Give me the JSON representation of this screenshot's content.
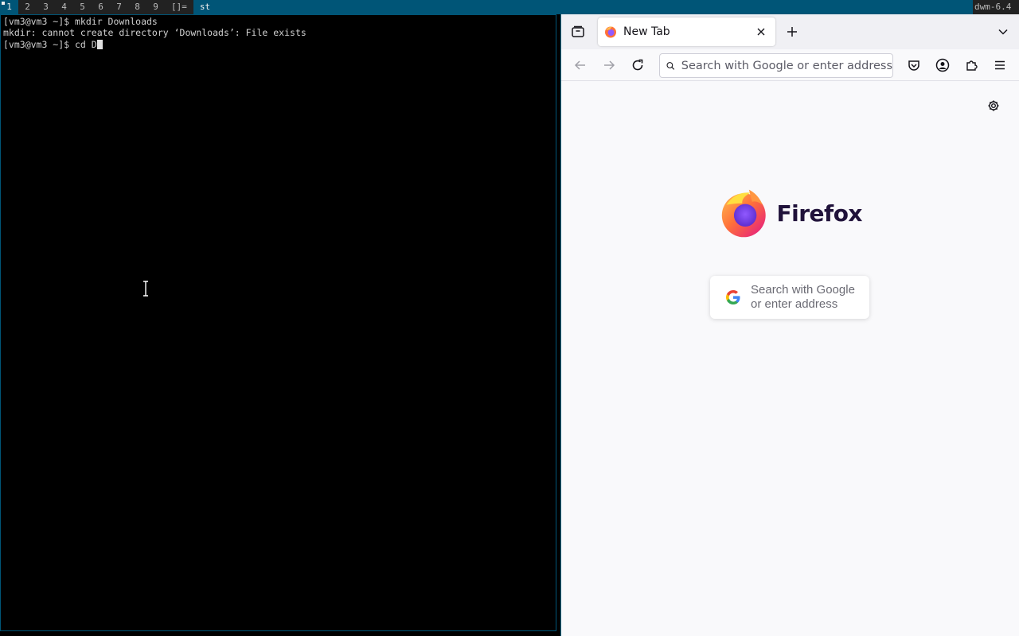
{
  "bar": {
    "tags": [
      "1",
      "2",
      "3",
      "4",
      "5",
      "6",
      "7",
      "8",
      "9"
    ],
    "layout": "[]=",
    "window_title": "st",
    "status": "dwm-6.4"
  },
  "terminal": {
    "lines": [
      "[vm3@vm3 ~]$ mkdir Downloads",
      "mkdir: cannot create directory ‘Downloads’: File exists",
      "[vm3@vm3 ~]$ cd D"
    ]
  },
  "browser": {
    "tab_title": "New Tab",
    "url_placeholder": "Search with Google or enter address",
    "logo_text": "Firefox",
    "search_placeholder": "Search with Google or enter address",
    "colors": {
      "accent": "#005577",
      "toolbar": "#f0f0f4",
      "page": "#f9f9fb"
    }
  }
}
